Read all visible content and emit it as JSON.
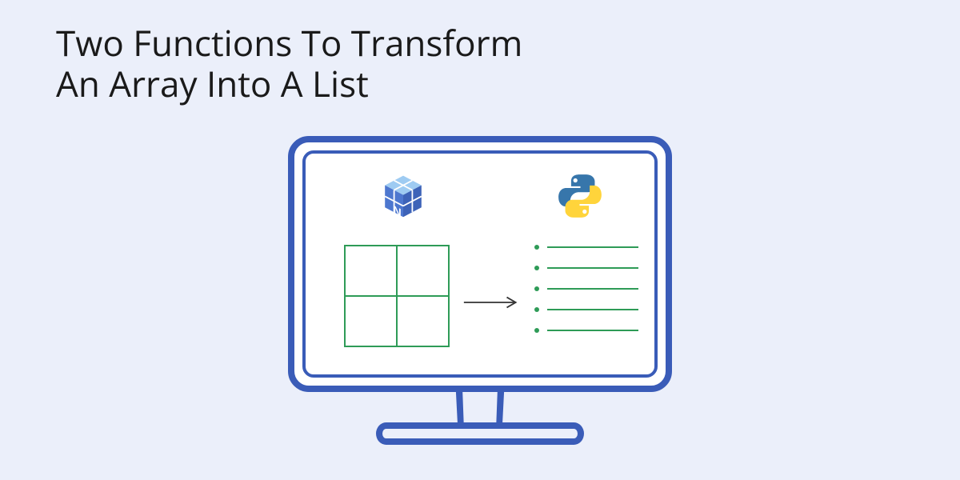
{
  "title_line1": "Two Functions To Transform",
  "title_line2": "An Array Into A List",
  "icons": {
    "left_logo": "numpy",
    "right_logo": "python"
  },
  "diagram": {
    "array_grid": {
      "rows": 2,
      "cols": 2
    },
    "arrow": "right",
    "list_items_count": 5
  },
  "colors": {
    "background": "#ebeffa",
    "monitor_border": "#3a5cb8",
    "accent_green": "#2e9b57",
    "numpy_blue": "#4d77cf",
    "numpy_light": "#9ecbf2",
    "python_blue": "#3776ab",
    "python_yellow": "#ffd43b"
  }
}
